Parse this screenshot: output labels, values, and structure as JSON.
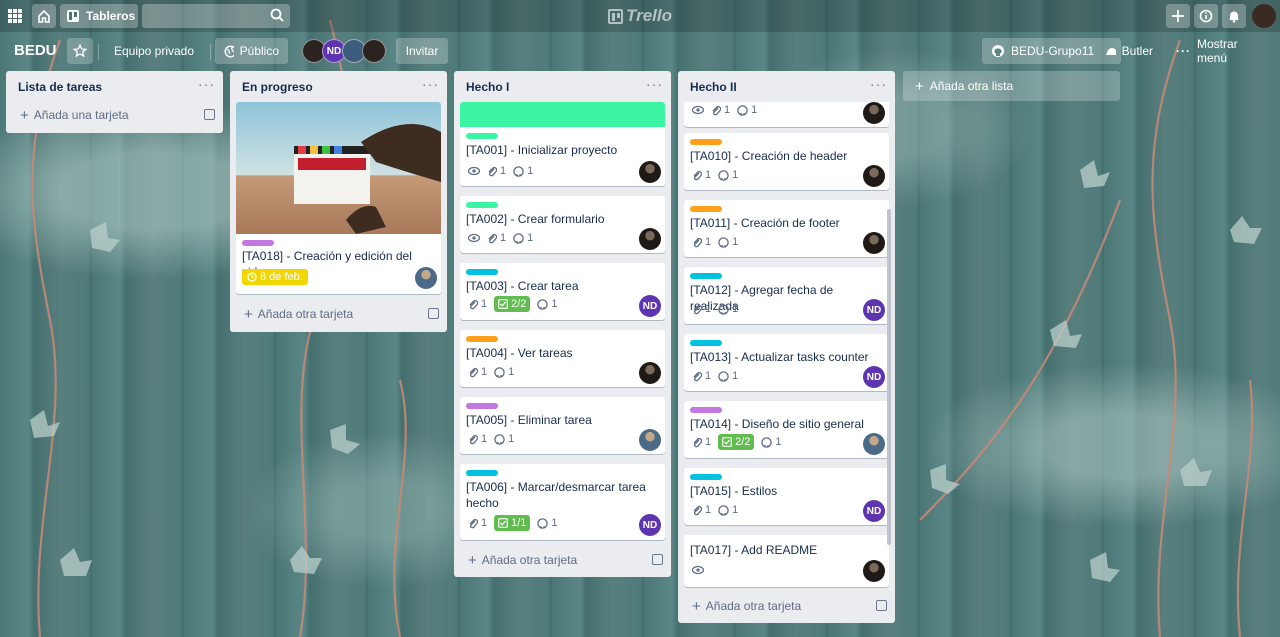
{
  "topbar": {
    "boards_label": "Tableros",
    "logo_text": "Trello"
  },
  "board": {
    "title": "BEDU",
    "team_label": "Equipo privado",
    "visibility_label": "Público",
    "invite_label": "Invitar",
    "github_label": "BEDU-Grupo11",
    "butler_label": "Butler",
    "menu_label": "Mostrar menú",
    "members": [
      "ND"
    ]
  },
  "lists": [
    {
      "title": "Lista de tareas",
      "add_label": "Añada una tarjeta",
      "cards": []
    },
    {
      "title": "En progreso",
      "add_label": "Añada otra tarjeta",
      "cards": [
        {
          "title": "[TA018] - Creación y edición del video",
          "label_color": "#c377e0",
          "due": "8 de feb.",
          "member": "photo"
        }
      ]
    },
    {
      "title": "Hecho I",
      "add_label": "Añada otra tarjeta",
      "cards": [
        {
          "title": "[TA001] - Inicializar proyecto",
          "label_color": "#3cf5a4",
          "attachments": "1",
          "github": "1",
          "member": "photo"
        },
        {
          "title": "[TA002] - Crear formulario",
          "label_color": "#3cf5a4",
          "attachments": "1",
          "github": "1",
          "member": "photo"
        },
        {
          "title": "[TA003] - Crear tarea",
          "label_color": "#00c2e0",
          "attachments": "1",
          "checklist": "2/2",
          "github": "1",
          "member": "ND"
        },
        {
          "title": "[TA004] - Ver tareas",
          "label_color": "#ff9f1a",
          "attachments": "1",
          "github": "1",
          "member": "photo"
        },
        {
          "title": "[TA005] - Eliminar tarea",
          "label_color": "#c377e0",
          "attachments": "1",
          "github": "1",
          "member": "photo"
        },
        {
          "title": "[TA006] - Marcar/desmarcar tarea hecho",
          "label_color": "#00c2e0",
          "attachments": "1",
          "checklist": "1/1",
          "github": "1",
          "member": "ND"
        }
      ]
    },
    {
      "title": "Hecho II",
      "add_label": "Añada otra tarjeta",
      "cards": [
        {
          "title": "",
          "attachments": "1",
          "github": "1",
          "member": "photo"
        },
        {
          "title": "[TA010] - Creación de header",
          "label_color": "#ff9f1a",
          "attachments": "1",
          "github": "1",
          "member": "photo"
        },
        {
          "title": "[TA011] - Creación de footer",
          "label_color": "#ff9f1a",
          "attachments": "1",
          "github": "1",
          "member": "photo"
        },
        {
          "title": "[TA012] - Agregar fecha de realizada",
          "label_color": "#00c2e0",
          "attachments": "1",
          "github": "1",
          "member": "ND"
        },
        {
          "title": "[TA013] - Actualizar tasks counter",
          "label_color": "#00c2e0",
          "attachments": "1",
          "github": "1",
          "member": "ND"
        },
        {
          "title": "[TA014] - Diseño de sitio general",
          "label_color": "#c377e0",
          "attachments": "1",
          "checklist": "2/2",
          "github": "1",
          "member": "photo"
        },
        {
          "title": "[TA015] - Estilos",
          "label_color": "#00c2e0",
          "attachments": "1",
          "github": "1",
          "member": "ND"
        },
        {
          "title": "[TA017] - Add README",
          "member": "photo"
        }
      ]
    }
  ],
  "add_list_label": "Añada otra lista"
}
